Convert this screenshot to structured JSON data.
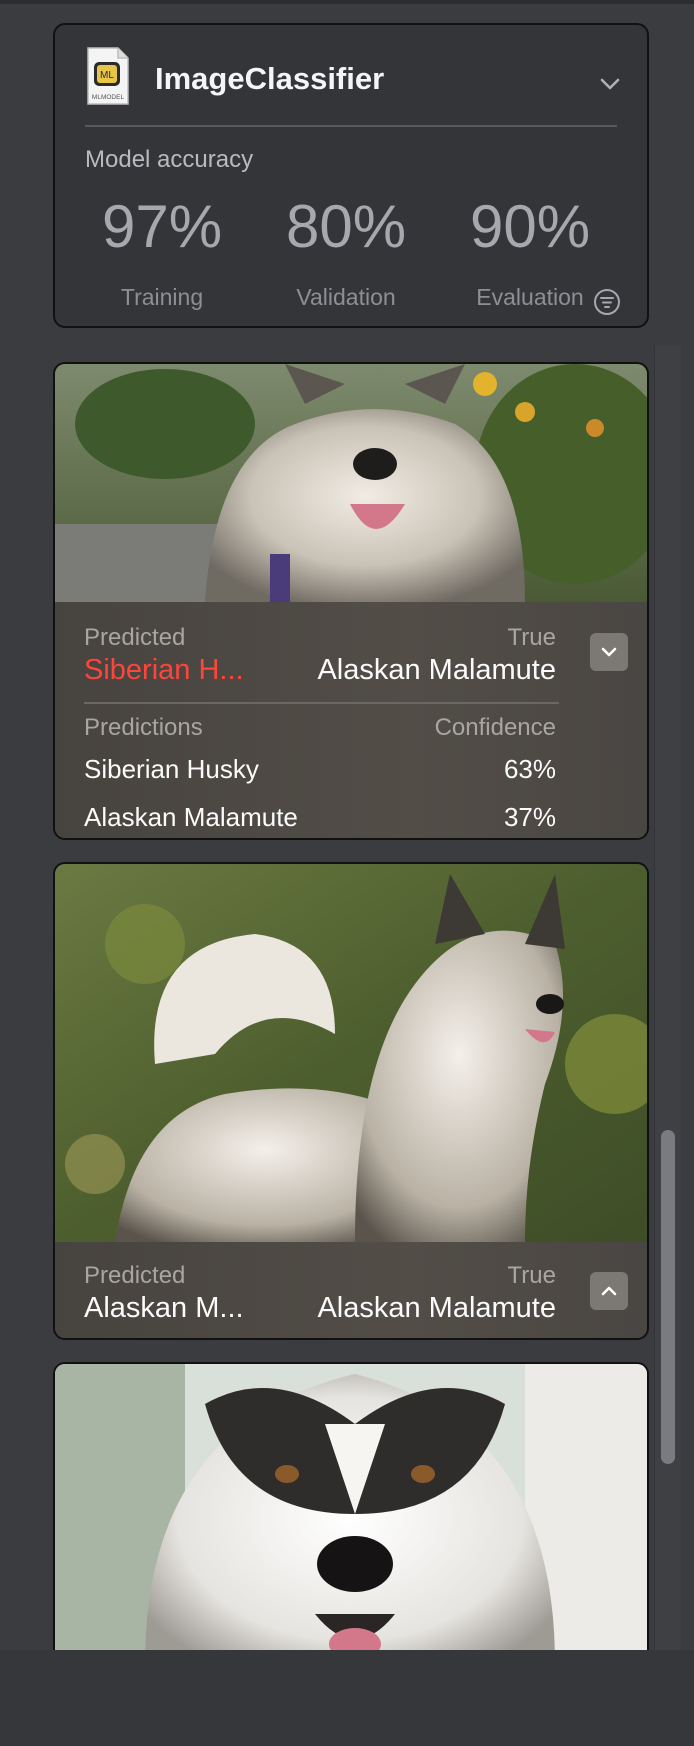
{
  "model": {
    "file_badge": "ML",
    "file_type": "MLMODEL",
    "name": "ImageClassifier",
    "accuracy_label": "Model accuracy",
    "metrics": [
      {
        "value": "97%",
        "label": "Training"
      },
      {
        "value": "80%",
        "label": "Validation"
      },
      {
        "value": "90%",
        "label": "Evaluation"
      }
    ]
  },
  "samples": [
    {
      "predicted_label": "Predicted",
      "predicted_value": "Siberian H...",
      "true_label": "True",
      "true_value": "Alaskan Malamute",
      "expanded": true,
      "predictions_header": "Predictions",
      "confidence_header": "Confidence",
      "predictions": [
        {
          "name": "Siberian Husky",
          "confidence": "63%"
        },
        {
          "name": "Alaskan Malamute",
          "confidence": "37%"
        }
      ]
    },
    {
      "predicted_label": "Predicted",
      "predicted_value": "Alaskan M...",
      "true_label": "True",
      "true_value": "Alaskan Malamute",
      "expanded": false
    },
    {}
  ],
  "icons": {
    "model_dropdown": "chevron-down-icon",
    "filter": "filter-icon",
    "collapse": "chevron-down-icon",
    "expand": "chevron-up-icon"
  },
  "colors": {
    "mispredicted": "#ff453a",
    "background": "#3b3c40"
  }
}
